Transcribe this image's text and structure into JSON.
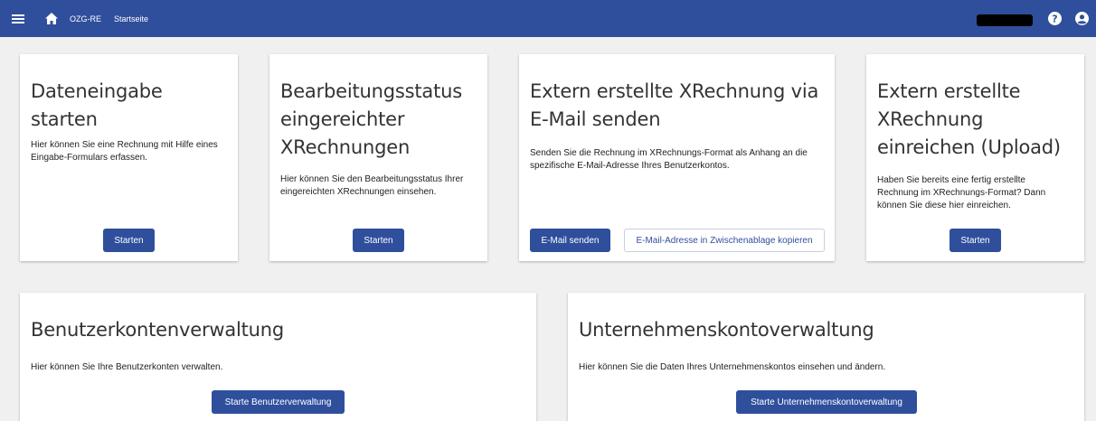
{
  "topbar": {
    "app_name": "OZG-RE",
    "breadcrumb": "Startseite"
  },
  "cards": {
    "dateneingabe": {
      "title": "Dateneingabe starten",
      "text": "Hier können Sie eine Rechnung mit Hilfe eines Eingabe-Formulars erfassen.",
      "button": "Starten"
    },
    "bearbeitungsstatus": {
      "title": "Bearbeitungsstatus eingereichter XRechnungen",
      "text": "Hier können Sie den Bearbeitungsstatus Ihrer eingereichten XRechnungen einsehen.",
      "button": "Starten"
    },
    "email": {
      "title": "Extern erstellte XRechnung via E-Mail senden",
      "text": "Senden Sie die Rechnung im XRechnungs-Format als Anhang an die spezifische E-Mail-Adresse Ihres Benutzerkontos.",
      "button": "E-Mail senden",
      "button_secondary": "E-Mail-Adresse in Zwischenablage kopieren"
    },
    "upload": {
      "title": "Extern erstellte XRechnung einreichen (Upload)",
      "text": "Haben Sie bereits eine fertig erstellte Rechnung im XRechnungs-Format? Dann können Sie diese hier einreichen.",
      "button": "Starten"
    },
    "benutzerkonten": {
      "title": "Benutzerkontenverwaltung",
      "text": "Hier können Sie Ihre Benutzerkonten verwalten.",
      "button": "Starte Benutzerverwaltung"
    },
    "unternehmenskonto": {
      "title": "Unternehmenskontoverwaltung",
      "text": "Hier können Sie die Daten Ihres Unternehmenskontos einsehen und ändern.",
      "button": "Starte Unternehmenskontoverwaltung"
    }
  },
  "icons": {
    "menu": "menu-icon",
    "home": "home-icon",
    "help": "help-icon",
    "user": "user-icon"
  },
  "colors": {
    "primary": "#2f4f9c",
    "background": "#f0f0f0"
  }
}
